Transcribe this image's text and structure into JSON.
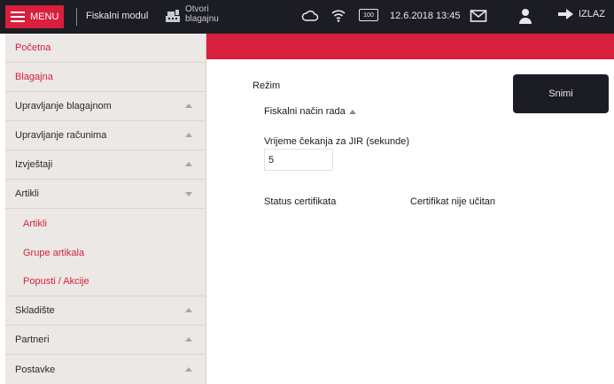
{
  "header": {
    "menu_label": "MENU",
    "module_name": "Fiskalni modul",
    "open_register": "Otvori blagajnu",
    "battery": "100",
    "datetime": "12.6.2018 13:45",
    "logout_label": "IZLAZ",
    "icons": [
      "hamburger-icon",
      "cash-register-icon",
      "cloud-icon",
      "wifi-icon",
      "battery-icon",
      "mail-icon",
      "user-icon",
      "arrow-right-icon"
    ]
  },
  "sidebar": {
    "items": [
      {
        "label": "Početna",
        "style": "red"
      },
      {
        "label": "Blagajna",
        "style": "red"
      },
      {
        "label": "Upravljanje blagajnom",
        "style": "dark",
        "caret": "up"
      },
      {
        "label": "Upravljanje računima",
        "style": "dark",
        "caret": "up"
      },
      {
        "label": "Izvještaji",
        "style": "dark",
        "caret": "up"
      },
      {
        "label": "Artikli",
        "style": "dark",
        "caret": "down"
      },
      {
        "label": "Artikli",
        "style": "sub"
      },
      {
        "label": "Grupe artikala",
        "style": "sub"
      },
      {
        "label": "Popusti / Akcije",
        "style": "sub"
      },
      {
        "label": "Skladište",
        "style": "dark",
        "caret": "up"
      },
      {
        "label": "Partneri",
        "style": "dark",
        "caret": "up"
      },
      {
        "label": "Postavke",
        "style": "dark",
        "caret": "up"
      }
    ]
  },
  "main": {
    "mode_label": "Režim",
    "mode_value": "Fiskalni način rada",
    "wait_label": "Vrijeme čekanja za JIR (sekunde)",
    "wait_value": "5",
    "status_label": "Status certifikata",
    "status_value": "Certifikat nije učitan",
    "save_label": "Snimi"
  },
  "colors": {
    "accent": "#d81f3c",
    "topbar": "#1c1c24",
    "sidebar_bg": "#ebe8e5"
  }
}
